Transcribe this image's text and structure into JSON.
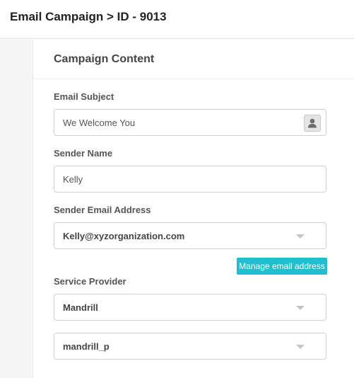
{
  "header": {
    "title": "Email Campaign > ID - 9013"
  },
  "panel": {
    "title": "Campaign Content"
  },
  "form": {
    "email_subject": {
      "label": "Email Subject",
      "value": "We Welcome You",
      "icon": "user-icon"
    },
    "sender_name": {
      "label": "Sender Name",
      "value": "Kelly"
    },
    "sender_email": {
      "label": "Sender Email Address",
      "value": "Kelly@xyzorganization.com"
    },
    "manage_email_label": "Manage email address",
    "service_provider": {
      "label": "Service Provider",
      "provider_value": "Mandrill",
      "account_value": "mandrill_p"
    }
  },
  "colors": {
    "accent": "#1fbfcf"
  }
}
